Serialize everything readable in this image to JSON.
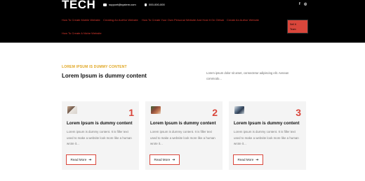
{
  "header": {
    "logo": "TECH",
    "email": "support@system.com",
    "phone": "000-000-000",
    "social": [
      "f",
      "◎"
    ],
    "nav": [
      "How To Create Mobile Website",
      "Creating An AutHor Website",
      "How To Create Your Own Personal Website And Host It On Github",
      "Create An Author Website",
      "How To Create A Niche Website"
    ],
    "cta_lines": [
      "Sell It",
      "Team"
    ]
  },
  "intro": {
    "eyebrow": "LOREM IPSUM IS DUMMY CONTENT",
    "title": "Lorem Ipsum is dummy content",
    "text": "Lorem ipsum dolor sit amet, consectetur adipiscing elit. Aenean commodo..."
  },
  "cards": [
    {
      "number": "1",
      "title": "Lorem Ipsum is dummy content",
      "text": "Lorem ipsum is dummy content. It is filler text used to make a website look more like a human wrote it...",
      "button": "Read More"
    },
    {
      "number": "2",
      "title": "Lorem Ipsum is dummy content",
      "text": "Lorem ipsum is dummy content. It is filler text used to make a website look more like a human wrote it...",
      "button": "Read More"
    },
    {
      "number": "3",
      "title": "Lorem Ipsum is dummy content",
      "text": "Lorem ipsum is dummy content. It is filler text used to make a website look more like a human wrote it...",
      "button": "Read More"
    }
  ],
  "colors": {
    "header_bg": "#000000",
    "accent_red": "#d9463b",
    "accent_gold": "#e0a51f"
  }
}
